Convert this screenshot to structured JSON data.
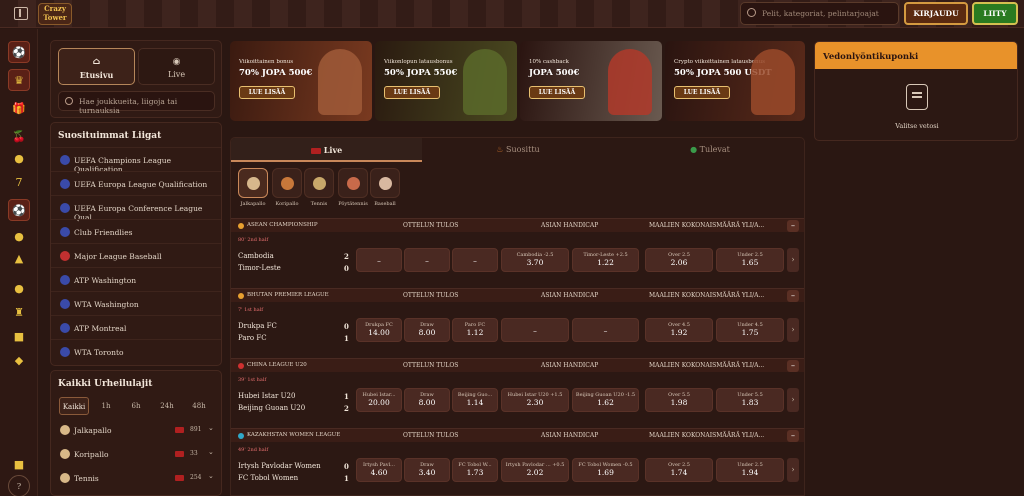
{
  "header": {
    "logo": "Crazy Tower",
    "search_placeholder": "Pelit, kategoriat, pelintarjoajat",
    "login": "KIRJAUDU",
    "join": "LIITY"
  },
  "nav_tabs": [
    {
      "label": "Etusivu"
    },
    {
      "label": "Live"
    }
  ],
  "left_search_placeholder": "Hae joukkueita, liigoja tai turnauksia",
  "popular": {
    "title": "Suosituimmat Liigat",
    "leagues": [
      "UEFA Champions League Qualification",
      "UEFA Europa League Qualification",
      "UEFA Europa Conference League Qual...",
      "Club Friendlies",
      "Major League Baseball",
      "ATP Washington",
      "WTA Washington",
      "ATP Montreal",
      "WTA Toronto"
    ]
  },
  "all_sports": {
    "title": "Kaikki Urheilulajit",
    "filters": [
      "Kaikki",
      "1h",
      "6h",
      "24h",
      "48h"
    ],
    "sports": [
      {
        "name": "Jalkapallo",
        "count": "891"
      },
      {
        "name": "Koripallo",
        "count": "33"
      },
      {
        "name": "Tennis",
        "count": "254"
      }
    ]
  },
  "promos": [
    {
      "small": "Viikoittainen bonus",
      "big": "70% JOPA 500€",
      "btn": "LUE LISÄÄ"
    },
    {
      "small": "Viikonlopun latausbonus",
      "big": "50% JOPA 550€",
      "btn": "LUE LISÄÄ"
    },
    {
      "small": "10% cashback",
      "big": "JOPA 500€",
      "btn": "LUE LISÄÄ"
    },
    {
      "small": "Crypto viikoittainen latausbonus",
      "big": "50% JOPA 500 USDT",
      "btn": "LUE LISÄÄ"
    }
  ],
  "main_tabs": [
    {
      "label": "Live"
    },
    {
      "label": "Suosittu"
    },
    {
      "label": "Tulevat"
    }
  ],
  "sports_icons": [
    "Jalkapallo",
    "Koripallo",
    "Tennis",
    "Pöytätennis",
    "Baseball"
  ],
  "headers": {
    "result": "OTTELUN TULOS",
    "handicap": "ASIAN HANDICAP",
    "total": "MAALIEN KOKONAISMÄÄRÄ YLI/A..."
  },
  "matches": [
    {
      "league": "ASEAN CHAMPIONSHIP",
      "time": "80' 2nd half",
      "team1": "Cambodia",
      "team2": "Timor-Leste",
      "score1": "2",
      "score2": "0",
      "odds": [
        {
          "l": "",
          "v": "–"
        },
        {
          "l": "",
          "v": "–"
        },
        {
          "l": "",
          "v": "–"
        },
        {
          "l": "Cambodia -2.5",
          "v": "3.70"
        },
        {
          "l": "Timor-Leste +2.5",
          "v": "1.22"
        },
        {
          "l": "Over 2.5",
          "v": "2.06"
        },
        {
          "l": "Under 2.5",
          "v": "1.65"
        }
      ]
    },
    {
      "league": "BHUTAN PREMIER LEAGUE",
      "time": "7' 1st half",
      "team1": "Drukpa FC",
      "team2": "Paro FC",
      "score1": "0",
      "score2": "1",
      "odds": [
        {
          "l": "Drukpa FC",
          "v": "14.00"
        },
        {
          "l": "Draw",
          "v": "8.00"
        },
        {
          "l": "Paro FC",
          "v": "1.12"
        },
        {
          "l": "",
          "v": "–"
        },
        {
          "l": "",
          "v": "–"
        },
        {
          "l": "Over 4.5",
          "v": "1.92"
        },
        {
          "l": "Under 4.5",
          "v": "1.75"
        }
      ]
    },
    {
      "league": "CHINA LEAGUE U20",
      "time": "39' 1st half",
      "team1": "Hubei Istar U20",
      "team2": "Beijing Guoan U20",
      "score1": "1",
      "score2": "2",
      "odds": [
        {
          "l": "Hubei Istar...",
          "v": "20.00"
        },
        {
          "l": "Draw",
          "v": "8.00"
        },
        {
          "l": "Beijing Guo...",
          "v": "1.14"
        },
        {
          "l": "Hubei Istar U20 +1.5",
          "v": "2.30"
        },
        {
          "l": "Beijing Guoan U20 -1.5",
          "v": "1.62"
        },
        {
          "l": "Over 5.5",
          "v": "1.98"
        },
        {
          "l": "Under 5.5",
          "v": "1.83"
        }
      ]
    },
    {
      "league": "KAZAKHSTAN WOMEN LEAGUE",
      "time": "49' 2nd half",
      "team1": "Irtysh Pavlodar Women",
      "team2": "FC Tobol Women",
      "score1": "0",
      "score2": "1",
      "odds": [
        {
          "l": "Irtysh Pavl...",
          "v": "4.60"
        },
        {
          "l": "Draw",
          "v": "3.40"
        },
        {
          "l": "FC Tobol W...",
          "v": "1.73"
        },
        {
          "l": "Irtysh Pavlodar ... +0.5",
          "v": "2.02"
        },
        {
          "l": "FC Tobol Women -0.5",
          "v": "1.69"
        },
        {
          "l": "Over 2.5",
          "v": "1.74"
        },
        {
          "l": "Under 2.5",
          "v": "1.94"
        }
      ]
    }
  ],
  "coupon": {
    "title": "Vedonlyöntikuponki",
    "message": "Valitse vetosi"
  }
}
